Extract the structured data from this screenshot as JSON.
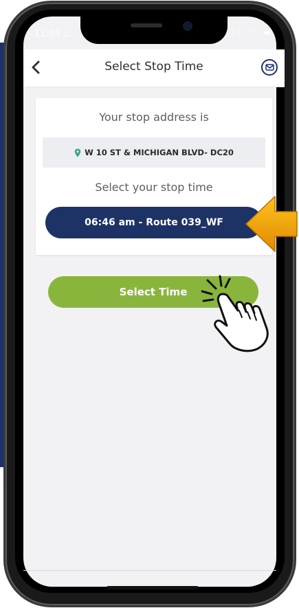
{
  "status_bar": {
    "time": "11:03 ⟂",
    "icons": "ıl ◠ ▬"
  },
  "header": {
    "title": "Select Stop Time",
    "back_icon": "chevron-left-icon",
    "mail_icon": "envelope-icon"
  },
  "card": {
    "address_heading": "Your stop address is",
    "address": "W 10 ST & MICHIGAN BLVD- DC20",
    "address_icon": "map-pin-icon",
    "time_heading": "Select your stop time",
    "time_option": "06:46 am - Route 039_WF"
  },
  "actions": {
    "select_time_label": "Select Time"
  },
  "colors": {
    "navy": "#1d3366",
    "green": "#8ab53d",
    "pin": "#3aa58b",
    "arrow": "#f2a300"
  }
}
